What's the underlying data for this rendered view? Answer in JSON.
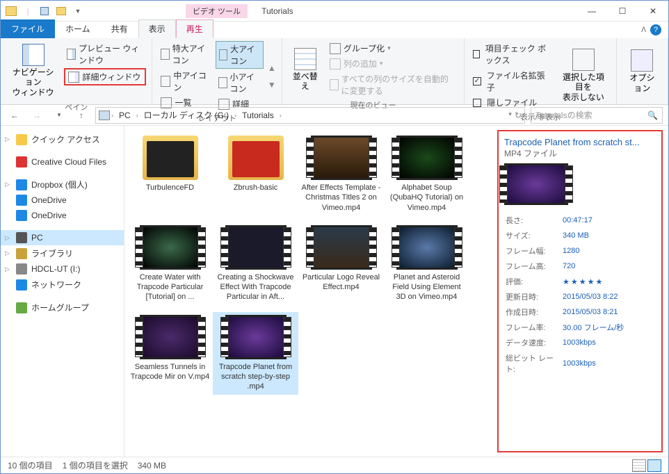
{
  "window": {
    "context_tab": "ビデオ ツール",
    "title": "Tutorials"
  },
  "tabs": {
    "file": "ファイル",
    "home": "ホーム",
    "share": "共有",
    "view": "表示",
    "play": "再生"
  },
  "ribbon": {
    "panes": {
      "label": "ペイン",
      "nav": "ナビゲーション\nウィンドウ",
      "preview": "プレビュー ウィンドウ",
      "details": "詳細ウィンドウ"
    },
    "layout": {
      "label": "レイアウト",
      "extra_large": "特大アイコン",
      "large": "大アイコン",
      "medium": "中アイコン",
      "small": "小アイコン",
      "list": "一覧",
      "details": "詳細"
    },
    "current_view": {
      "label": "現在のビュー",
      "sort": "並べ替え",
      "group": "グループ化",
      "add_col": "列の追加",
      "autosize": "すべての列のサイズを自動的に変更する"
    },
    "showhide": {
      "label": "表示/非表示",
      "checkboxes": "項目チェック ボックス",
      "extensions": "ファイル名拡張子",
      "hidden": "隠しファイル",
      "hide_selected": "選択した項目を\n表示しない"
    },
    "options": "オプション"
  },
  "breadcrumb": [
    "PC",
    "ローカル ディスク (G:)",
    "Tutorials"
  ],
  "search_placeholder": "Tutorialsの検索",
  "nav": [
    {
      "label": "クイック アクセス",
      "icon": "star",
      "caret": true
    },
    {
      "label": "Creative Cloud Files",
      "icon": "cc"
    },
    {
      "label": "Dropbox (個人)",
      "icon": "db",
      "caret": true
    },
    {
      "label": "OneDrive",
      "icon": "od"
    },
    {
      "label": "OneDrive",
      "icon": "od"
    },
    {
      "label": "PC",
      "icon": "pc",
      "caret": true,
      "selected": true
    },
    {
      "label": "ライブラリ",
      "icon": "lib",
      "caret": true
    },
    {
      "label": "HDCL-UT (I:)",
      "icon": "hdd",
      "caret": true
    },
    {
      "label": "ネットワーク",
      "icon": "net"
    },
    {
      "label": "ホームグループ",
      "icon": "hg"
    }
  ],
  "items": [
    {
      "name": "TurbulenceFD",
      "type": "folder",
      "bg": "#222"
    },
    {
      "name": "Zbrush-basic",
      "type": "folder",
      "bg": "#c82a1e"
    },
    {
      "name": "After Effects Template - Christmas Titles 2 on Vimeo.mp4",
      "type": "video",
      "bg": "linear-gradient(#6b4a2a,#2a1a0a)"
    },
    {
      "name": "Alphabet Soup (QubaHQ Tutorial) on Vimeo.mp4",
      "type": "video",
      "bg": "radial-gradient(#1a4a1a,#000)"
    },
    {
      "name": "Create Water with Trapcode Particular [Tutorial] on ...",
      "type": "video",
      "bg": "radial-gradient(#3a6a4a,#000)"
    },
    {
      "name": "Creating a Shockwave Effect With Trapcode Particular in Aft...",
      "type": "video",
      "bg": "#1a1a2a"
    },
    {
      "name": "Particular Logo Reveal Effect.mp4",
      "type": "video",
      "bg": "linear-gradient(#2a3a4a,#3a2a1a)"
    },
    {
      "name": "Planet and Asteroid Field Using Element 3D on Vimeo.mp4",
      "type": "video",
      "bg": "radial-gradient(#5a7aaa,#0a1a2a)"
    },
    {
      "name": "Seamless Tunnels in Trapcode Mir on V.mp4",
      "type": "video",
      "bg": "radial-gradient(#4a2a6a,#1a0a2a)"
    },
    {
      "name": "Trapcode Planet from scratch step-by-step .mp4",
      "type": "video",
      "bg": "radial-gradient(#6a3a9a,#1a0a3a)",
      "selected": true
    }
  ],
  "details": {
    "title": "Trapcode Planet from scratch st...",
    "subtitle": "MP4 ファイル",
    "thumb_bg": "radial-gradient(#6a3a9a,#1a0a3a)",
    "props": [
      {
        "k": "長さ:",
        "v": "00:47:17"
      },
      {
        "k": "サイズ:",
        "v": "340 MB"
      },
      {
        "k": "フレーム幅:",
        "v": "1280"
      },
      {
        "k": "フレーム高:",
        "v": "720"
      },
      {
        "k": "評価:",
        "v": "★★★★★",
        "stars": true
      },
      {
        "k": "更新日時:",
        "v": "2015/05/03 8:22"
      },
      {
        "k": "作成日時:",
        "v": "2015/05/03 8:21"
      },
      {
        "k": "フレーム率:",
        "v": "30.00 フレーム/秒"
      },
      {
        "k": "データ速度:",
        "v": "1003kbps"
      },
      {
        "k": "総ビット レート:",
        "v": "1003kbps"
      }
    ]
  },
  "status": {
    "count": "10 個の項目",
    "selected": "1 個の項目を選択",
    "size": "340 MB"
  }
}
